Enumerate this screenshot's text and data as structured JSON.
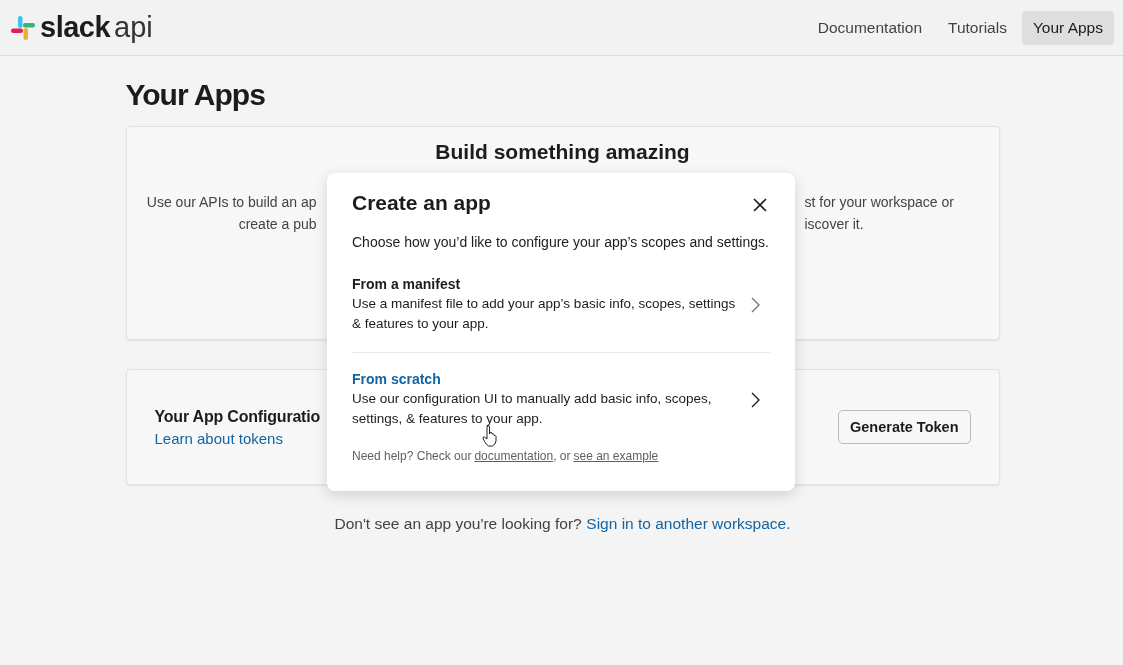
{
  "header": {
    "logo": {
      "word": "slack",
      "suffix": "api"
    },
    "nav": [
      {
        "label": "Documentation",
        "selected": false
      },
      {
        "label": "Tutorials",
        "selected": false
      },
      {
        "label": "Your Apps",
        "selected": true
      }
    ]
  },
  "page": {
    "title": "Your Apps"
  },
  "intro_card": {
    "title": "Build something amazing",
    "left_lines": [
      "Use our APIs to build an ap",
      "create a pub"
    ],
    "right_lines": [
      "st for your workspace or",
      "iscover it."
    ]
  },
  "token_card": {
    "title": "Your App Configuratio",
    "link": "Learn about tokens",
    "button": "Generate Token"
  },
  "footer": {
    "text": "Don't see an app you're looking for?",
    "link": "Sign in to another workspace."
  },
  "modal": {
    "title": "Create an app",
    "description": "Choose how you’d like to configure your app’s scopes and settings.",
    "options": [
      {
        "title": "From a manifest",
        "description": "Use a manifest file to add your app’s basic info, scopes, settings & features to your app.",
        "highlighted": false
      },
      {
        "title": "From scratch",
        "description": "Use our configuration UI to manually add basic info, scopes, settings, & features to your app.",
        "highlighted": true
      }
    ],
    "help": {
      "text": "Need help? Check our",
      "link1": "documentation",
      "separator": ", or",
      "link2": "see an example"
    }
  }
}
